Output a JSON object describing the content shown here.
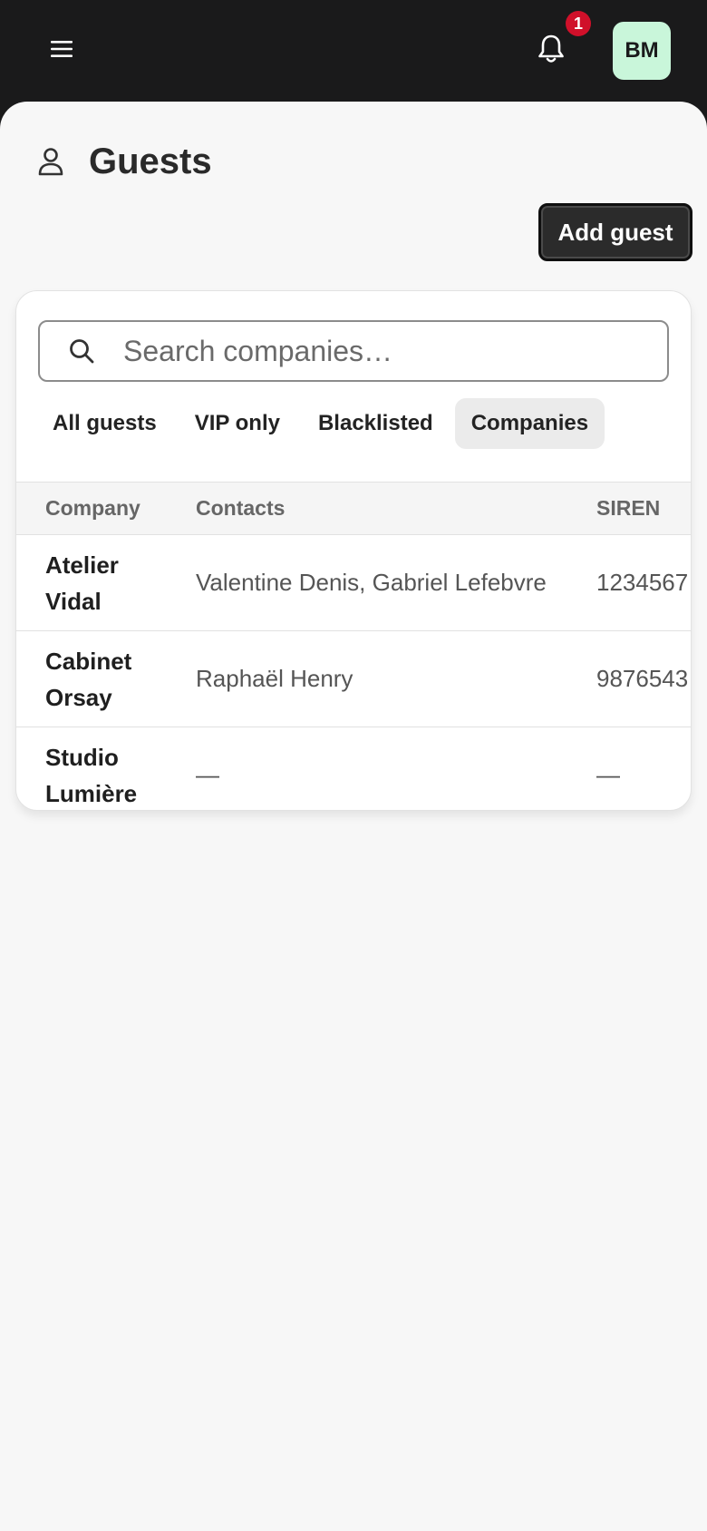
{
  "header": {
    "notification_count": "1",
    "avatar_initials": "BM"
  },
  "page": {
    "title": "Guests",
    "add_button_label": "Add guest"
  },
  "search": {
    "placeholder": "Search companies…"
  },
  "tabs": [
    {
      "label": "All guests",
      "active": false
    },
    {
      "label": "VIP only",
      "active": false
    },
    {
      "label": "Blacklisted",
      "active": false
    },
    {
      "label": "Companies",
      "active": true
    }
  ],
  "table": {
    "columns": [
      "Company",
      "Contacts",
      "SIREN"
    ],
    "rows": [
      {
        "company": "Atelier Vidal",
        "contacts": "Valentine Denis, Gabriel Lefebvre",
        "siren": "1234567"
      },
      {
        "company": "Cabinet Orsay",
        "contacts": "Raphaël Henry",
        "siren": "9876543"
      },
      {
        "company": "Studio Lumière",
        "contacts": "—",
        "siren": "—"
      }
    ]
  },
  "colors": {
    "topbar": "#1a1a1b",
    "badge": "#d0102a",
    "avatar_bg": "#c9f6da",
    "sheet_bg": "#f7f7f7"
  }
}
